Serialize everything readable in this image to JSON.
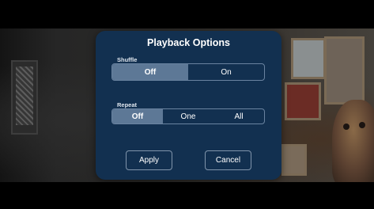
{
  "dialog": {
    "title": "Playback Options",
    "shuffle": {
      "label": "Shuffle",
      "options": [
        "Off",
        "On"
      ],
      "selected": "Off"
    },
    "repeat": {
      "label": "Repeat",
      "options": [
        "Off",
        "One",
        "All"
      ],
      "selected": "Off"
    },
    "apply_label": "Apply",
    "cancel_label": "Cancel"
  },
  "colors": {
    "dialog_background": "#123050",
    "selected_segment": "#5d7896",
    "segment_border": "#6a83a0"
  }
}
